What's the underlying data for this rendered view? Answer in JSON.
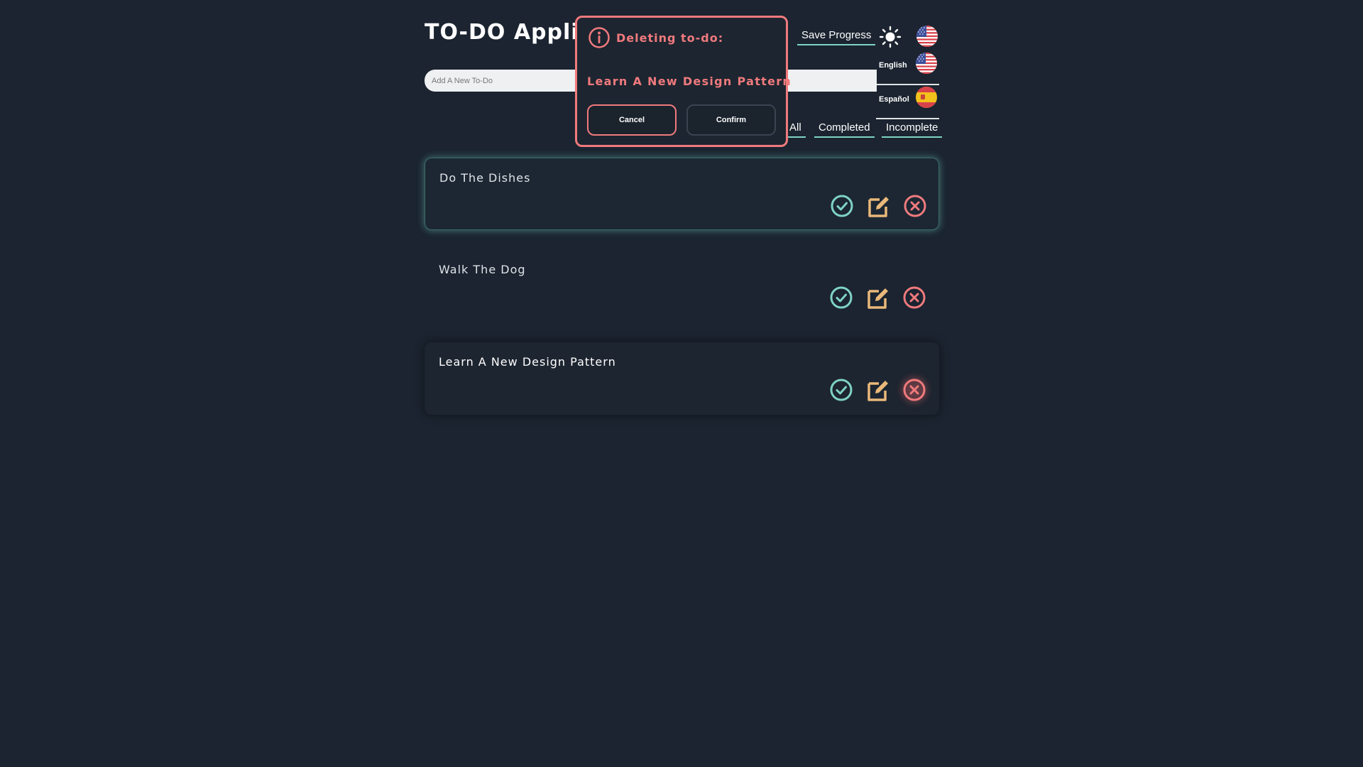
{
  "app": {
    "title": "TO-DO Application",
    "save_label": "Save Progress",
    "theme_icon": "sun-icon",
    "current_language_icon": "us-flag-icon"
  },
  "languages": [
    {
      "label": "English",
      "icon": "us-flag-icon"
    },
    {
      "label": "Español",
      "icon": "spain-flag-icon"
    }
  ],
  "input": {
    "placeholder": "Add A New To-Do",
    "value": ""
  },
  "filters": [
    "All",
    "Completed",
    "Incomplete"
  ],
  "todos": [
    {
      "text": "Do The Dishes"
    },
    {
      "text": "Walk The Dog"
    },
    {
      "text": "Learn A New Design Pattern"
    }
  ],
  "modal": {
    "icon": "info-icon",
    "heading": "Deleting to-do:",
    "item": "Learn A New Design Pattern",
    "cancel_label": "Cancel",
    "confirm_label": "Confirm"
  },
  "colors": {
    "background": "#1b2430",
    "accent_teal": "#7fd3c4",
    "danger_red": "#f07a7d",
    "edit_tan": "#e9b87a"
  }
}
